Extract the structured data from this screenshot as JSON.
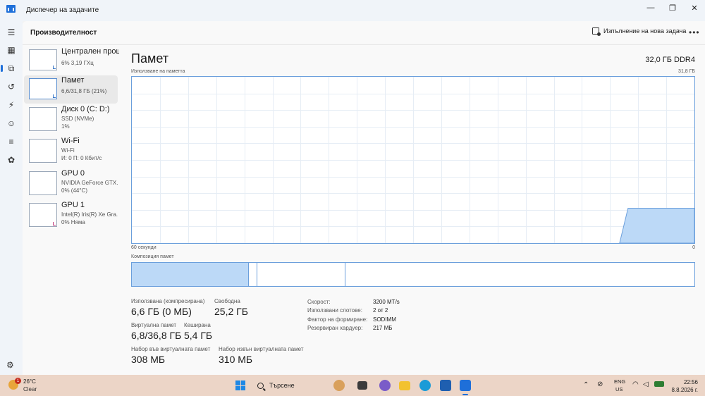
{
  "window": {
    "title": "Диспечер на задачите",
    "minimize": "—",
    "maximize": "❐",
    "close": "✕"
  },
  "header": {
    "section_title": "Производителност",
    "run_task": "Изпълнение на нова задача",
    "more": "•••"
  },
  "devices": [
    {
      "name": "Централен процесор",
      "line1": "6% 3,19 ГХц",
      "line2": ""
    },
    {
      "name": "Памет",
      "line1": "6,6/31,8 ГБ (21%)",
      "line2": ""
    },
    {
      "name": "Диск 0 (C: D:)",
      "line1": "SSD (NVMe)",
      "line2": "1%"
    },
    {
      "name": "Wi-Fi",
      "line1": "Wi-Fi",
      "line2": "И: 0 П: 0 Кбит/с"
    },
    {
      "name": "GPU 0",
      "line1": "NVIDIA GeForce GTX...",
      "line2": "0% (44°C)"
    },
    {
      "name": "GPU 1",
      "line1": "Intel(R) Iris(R) Xe Gra...",
      "line2": "0% Няма"
    }
  ],
  "detail": {
    "title": "Памет",
    "spec": "32,0 ГБ DDR4",
    "usage_label": "Използване на паметта",
    "usage_max": "31,8 ГБ",
    "time_left": "60 секунди",
    "time_right": "0",
    "composition_label": "Композиция памет",
    "usage_fraction": 0.21
  },
  "composition": {
    "in_use_fraction": 0.208,
    "modified_fraction": 0.015,
    "standby_fraction": 0.157
  },
  "stats": {
    "in_use_label": "Използвана (компресирана)",
    "in_use_value": "6,6 ГБ (0 МБ)",
    "available_label": "Свободна",
    "available_value": "25,2 ГБ",
    "committed_label": "Виртуална памет",
    "committed_value": "6,8/36,8 ГБ",
    "cached_label": "Кеширана",
    "cached_value": "5,4 ГБ",
    "paged_label": "Набор във виртуалната памет",
    "paged_value": "308 МБ",
    "nonpaged_label": "Набор извън виртуалната памет",
    "nonpaged_value": "310 МБ"
  },
  "specs": [
    {
      "label": "Скорост:",
      "value": "3200 MT/s"
    },
    {
      "label": "Използвани слотове:",
      "value": "2 от 2"
    },
    {
      "label": "Фактор на формиране:",
      "value": "SODIMM"
    },
    {
      "label": "Резервиран хардуер:",
      "value": "217 МБ"
    }
  ],
  "taskbar": {
    "weather_temp": "26°C",
    "weather_cond": "Clear",
    "weather_badge": "1",
    "search_placeholder": "Търсене",
    "lang_top": "ENG",
    "lang_bottom": "US",
    "time": "22:56",
    "date": "8.8.2026 г."
  },
  "colors": {
    "accent": "#1e6fd9",
    "graph_fill": "#bcd9f7",
    "graph_line": "#6b9fdc",
    "taskbar": "#ecd5c7"
  }
}
